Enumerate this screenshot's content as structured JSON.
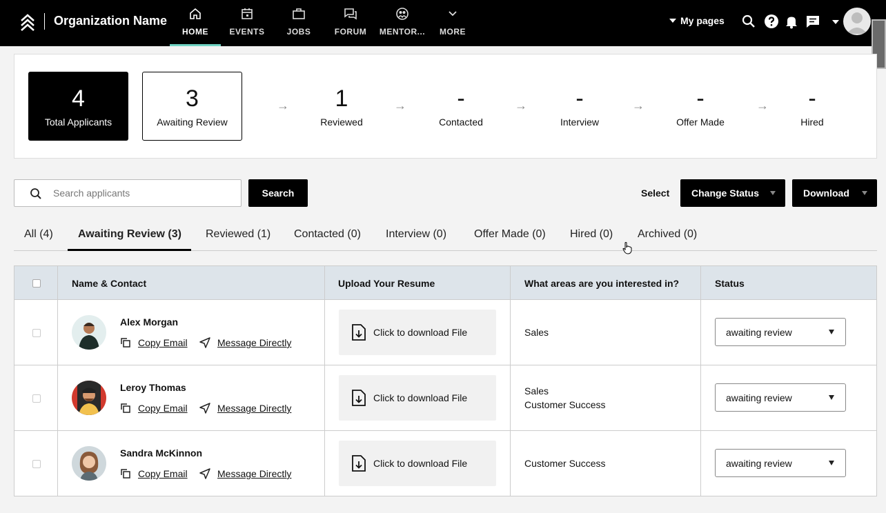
{
  "header": {
    "org_name": "Organization Name",
    "nav": [
      {
        "label": "HOME",
        "icon": "home-icon"
      },
      {
        "label": "EVENTS",
        "icon": "calendar-icon"
      },
      {
        "label": "JOBS",
        "icon": "briefcase-icon"
      },
      {
        "label": "FORUM",
        "icon": "chat-icon"
      },
      {
        "label": "MENTOR...",
        "icon": "mentor-icon"
      },
      {
        "label": "MORE",
        "icon": "chevron-down-icon"
      }
    ],
    "my_pages": "My pages"
  },
  "stats": {
    "total": {
      "value": "4",
      "label": "Total Applicants"
    },
    "awaiting": {
      "value": "3",
      "label": "Awaiting Review"
    },
    "reviewed": {
      "value": "1",
      "label": "Reviewed"
    },
    "contacted": {
      "value": "-",
      "label": "Contacted"
    },
    "interview": {
      "value": "-",
      "label": "Interview"
    },
    "offer": {
      "value": "-",
      "label": "Offer Made"
    },
    "hired": {
      "value": "-",
      "label": "Hired"
    },
    "arrow": "→"
  },
  "toolbar": {
    "search_placeholder": "Search applicants",
    "search_button": "Search",
    "select_label": "Select",
    "change_status": "Change Status",
    "download": "Download"
  },
  "tabs": [
    "All (4)",
    "Awaiting Review (3)",
    "Reviewed (1)",
    "Contacted (0)",
    "Interview (0)",
    "Offer Made (0)",
    "Hired (0)",
    "Archived (0)"
  ],
  "table": {
    "headers": {
      "name": "Name & Contact",
      "resume": "Upload Your Resume",
      "interest": "What areas are you interested in?",
      "status": "Status"
    },
    "copy_email": "Copy Email",
    "message": "Message Directly",
    "download_file": "Click to download File",
    "rows": [
      {
        "name": "Alex Morgan",
        "interest1": "Sales",
        "interest2": "",
        "status": "awaiting review"
      },
      {
        "name": "Leroy Thomas",
        "interest1": "Sales",
        "interest2": "Customer Success",
        "status": "awaiting review"
      },
      {
        "name": "Sandra McKinnon",
        "interest1": "Customer Success",
        "interest2": "",
        "status": "awaiting review"
      }
    ]
  },
  "colors": {
    "accent": "#6fd3c2",
    "header_bg": "#000000",
    "table_header_bg": "#dde4ea"
  }
}
